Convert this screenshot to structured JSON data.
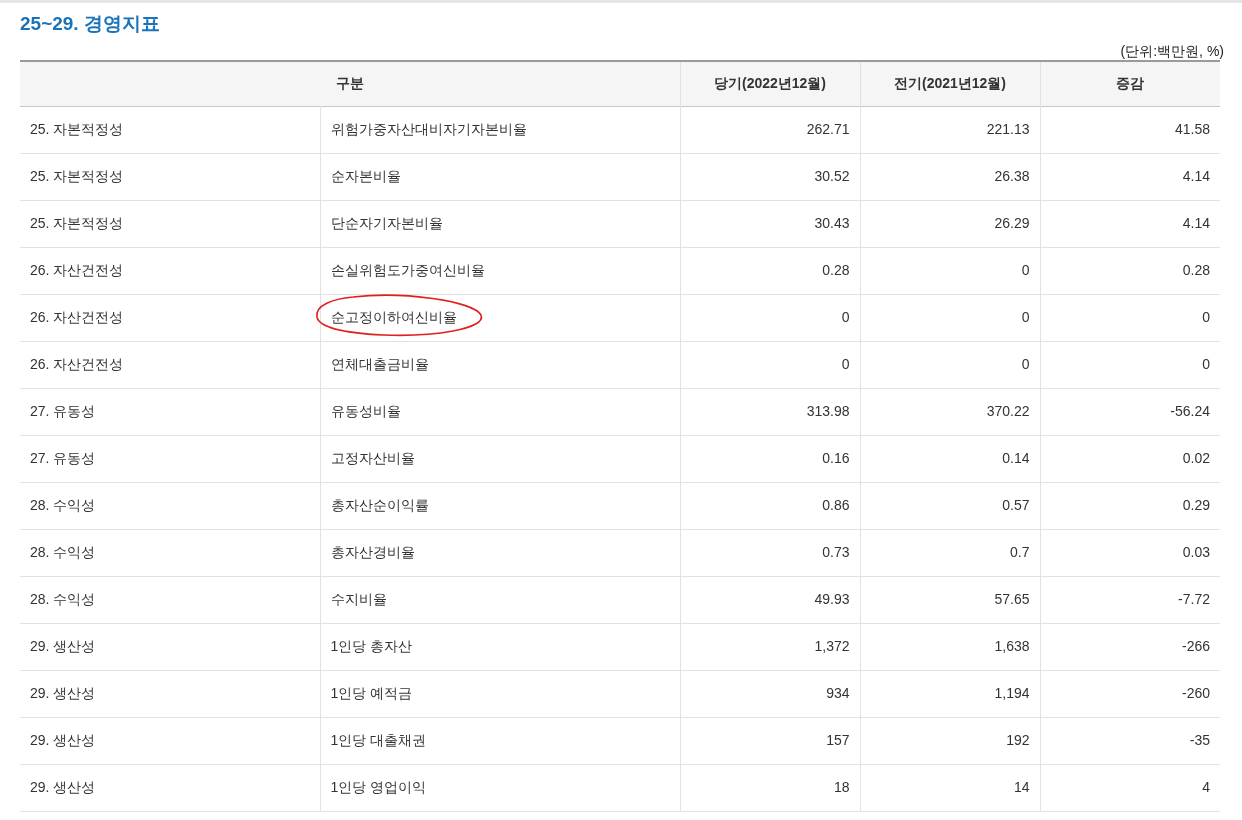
{
  "title": "25~29. 경영지표",
  "unit": "(단위:백만원, %)",
  "table": {
    "columns": [
      "구분",
      "당기(2022년12월)",
      "전기(2021년12월)",
      "증감"
    ],
    "rows": [
      {
        "category": "25. 자본적정성",
        "item": "위험가중자산대비자기자본비율",
        "current": "262.71",
        "previous": "221.13",
        "change": "41.58",
        "circled": false
      },
      {
        "category": "25. 자본적정성",
        "item": "순자본비율",
        "current": "30.52",
        "previous": "26.38",
        "change": "4.14",
        "circled": false
      },
      {
        "category": "25. 자본적정성",
        "item": "단순자기자본비율",
        "current": "30.43",
        "previous": "26.29",
        "change": "4.14",
        "circled": false
      },
      {
        "category": "26. 자산건전성",
        "item": "손실위험도가중여신비율",
        "current": "0.28",
        "previous": "0",
        "change": "0.28",
        "circled": false
      },
      {
        "category": "26. 자산건전성",
        "item": "순고정이하여신비율",
        "current": "0",
        "previous": "0",
        "change": "0",
        "circled": true
      },
      {
        "category": "26. 자산건전성",
        "item": "연체대출금비율",
        "current": "0",
        "previous": "0",
        "change": "0",
        "circled": false
      },
      {
        "category": "27. 유동성",
        "item": "유동성비율",
        "current": "313.98",
        "previous": "370.22",
        "change": "-56.24",
        "circled": false
      },
      {
        "category": "27. 유동성",
        "item": "고정자산비율",
        "current": "0.16",
        "previous": "0.14",
        "change": "0.02",
        "circled": false
      },
      {
        "category": "28. 수익성",
        "item": "총자산순이익률",
        "current": "0.86",
        "previous": "0.57",
        "change": "0.29",
        "circled": false
      },
      {
        "category": "28. 수익성",
        "item": "총자산경비율",
        "current": "0.73",
        "previous": "0.7",
        "change": "0.03",
        "circled": false
      },
      {
        "category": "28. 수익성",
        "item": "수지비율",
        "current": "49.93",
        "previous": "57.65",
        "change": "-7.72",
        "circled": false
      },
      {
        "category": "29. 생산성",
        "item": "1인당 총자산",
        "current": "1,372",
        "previous": "1,638",
        "change": "-266",
        "circled": false
      },
      {
        "category": "29. 생산성",
        "item": "1인당 예적금",
        "current": "934",
        "previous": "1,194",
        "change": "-260",
        "circled": false
      },
      {
        "category": "29. 생산성",
        "item": "1인당 대출채권",
        "current": "157",
        "previous": "192",
        "change": "-35",
        "circled": false
      },
      {
        "category": "29. 생산성",
        "item": "1인당 영업이익",
        "current": "18",
        "previous": "14",
        "change": "4",
        "circled": false
      }
    ]
  }
}
